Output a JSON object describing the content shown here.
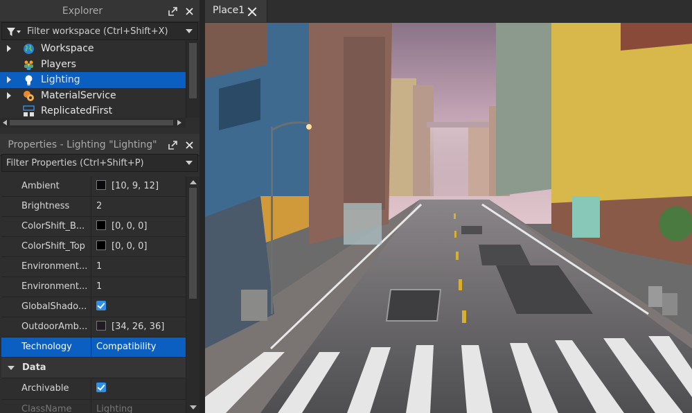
{
  "explorer": {
    "title": "Explorer",
    "filter_placeholder": "Filter workspace (Ctrl+Shift+X)",
    "items": [
      {
        "label": "Workspace",
        "icon": "globe-icon",
        "expandable": true,
        "selected": false
      },
      {
        "label": "Players",
        "icon": "players-icon",
        "expandable": false,
        "selected": false
      },
      {
        "label": "Lighting",
        "icon": "lightbulb-icon",
        "expandable": true,
        "selected": true
      },
      {
        "label": "MaterialService",
        "icon": "material-service-icon",
        "expandable": true,
        "selected": false
      },
      {
        "label": "ReplicatedFirst",
        "icon": "replicated-first-icon",
        "expandable": false,
        "selected": false
      }
    ]
  },
  "properties": {
    "title": "Properties - Lighting \"Lighting\"",
    "filter_placeholder": "Filter Properties (Ctrl+Shift+P)",
    "rows": [
      {
        "name": "Ambient",
        "value": "[10, 9, 12]",
        "kind": "color",
        "color": "#0a090c"
      },
      {
        "name": "Brightness",
        "value": "2",
        "kind": "text"
      },
      {
        "name": "ColorShift_B...",
        "value": "[0, 0, 0]",
        "kind": "color",
        "color": "#000000"
      },
      {
        "name": "ColorShift_Top",
        "value": "[0, 0, 0]",
        "kind": "color",
        "color": "#000000"
      },
      {
        "name": "Environment...",
        "value": "1",
        "kind": "text"
      },
      {
        "name": "Environment...",
        "value": "1",
        "kind": "text"
      },
      {
        "name": "GlobalShado...",
        "value": "",
        "kind": "check"
      },
      {
        "name": "OutdoorAmb...",
        "value": "[34, 26, 36]",
        "kind": "color",
        "color": "#221a24"
      },
      {
        "name": "Technology",
        "value": "Compatibility",
        "kind": "text",
        "selected": true
      }
    ],
    "group": {
      "label": "Data"
    },
    "data_rows": [
      {
        "name": "Archivable",
        "value": "",
        "kind": "check"
      },
      {
        "name": "ClassName",
        "value": "Lighting",
        "kind": "text",
        "dim": true
      }
    ]
  },
  "tabs": [
    {
      "label": "Place1"
    }
  ],
  "colors": {
    "selection": "#0b5fc0",
    "panel": "#2e2e2e",
    "checkbox": "#2f8fe6"
  }
}
